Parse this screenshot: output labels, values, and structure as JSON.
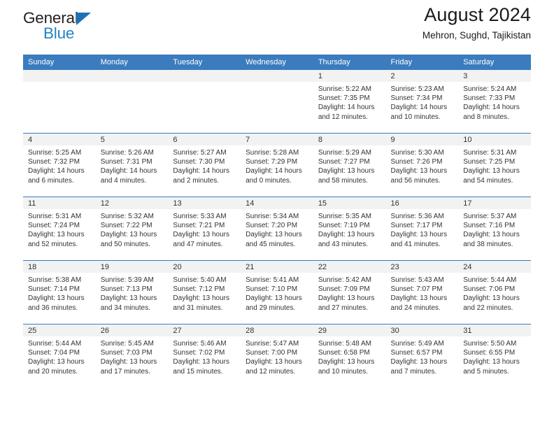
{
  "brand": {
    "name_top": "General",
    "name_bottom": "Blue",
    "accent_color": "#2483c5",
    "triangle_color": "#1b72b8"
  },
  "header": {
    "title": "August 2024",
    "subtitle": "Mehron, Sughd, Tajikistan"
  },
  "theme": {
    "header_row_bg": "#3a7cbe",
    "daynum_band_bg": "#f2f2f2",
    "grid_line": "#3a7cbe",
    "text": "#333333"
  },
  "calendar": {
    "weekday_headers": [
      "Sunday",
      "Monday",
      "Tuesday",
      "Wednesday",
      "Thursday",
      "Friday",
      "Saturday"
    ],
    "weeks": [
      [
        {
          "day": "",
          "lines": []
        },
        {
          "day": "",
          "lines": []
        },
        {
          "day": "",
          "lines": []
        },
        {
          "day": "",
          "lines": []
        },
        {
          "day": "1",
          "lines": [
            "Sunrise: 5:22 AM",
            "Sunset: 7:35 PM",
            "Daylight: 14 hours",
            "and 12 minutes."
          ]
        },
        {
          "day": "2",
          "lines": [
            "Sunrise: 5:23 AM",
            "Sunset: 7:34 PM",
            "Daylight: 14 hours",
            "and 10 minutes."
          ]
        },
        {
          "day": "3",
          "lines": [
            "Sunrise: 5:24 AM",
            "Sunset: 7:33 PM",
            "Daylight: 14 hours",
            "and 8 minutes."
          ]
        }
      ],
      [
        {
          "day": "4",
          "lines": [
            "Sunrise: 5:25 AM",
            "Sunset: 7:32 PM",
            "Daylight: 14 hours",
            "and 6 minutes."
          ]
        },
        {
          "day": "5",
          "lines": [
            "Sunrise: 5:26 AM",
            "Sunset: 7:31 PM",
            "Daylight: 14 hours",
            "and 4 minutes."
          ]
        },
        {
          "day": "6",
          "lines": [
            "Sunrise: 5:27 AM",
            "Sunset: 7:30 PM",
            "Daylight: 14 hours",
            "and 2 minutes."
          ]
        },
        {
          "day": "7",
          "lines": [
            "Sunrise: 5:28 AM",
            "Sunset: 7:29 PM",
            "Daylight: 14 hours",
            "and 0 minutes."
          ]
        },
        {
          "day": "8",
          "lines": [
            "Sunrise: 5:29 AM",
            "Sunset: 7:27 PM",
            "Daylight: 13 hours",
            "and 58 minutes."
          ]
        },
        {
          "day": "9",
          "lines": [
            "Sunrise: 5:30 AM",
            "Sunset: 7:26 PM",
            "Daylight: 13 hours",
            "and 56 minutes."
          ]
        },
        {
          "day": "10",
          "lines": [
            "Sunrise: 5:31 AM",
            "Sunset: 7:25 PM",
            "Daylight: 13 hours",
            "and 54 minutes."
          ]
        }
      ],
      [
        {
          "day": "11",
          "lines": [
            "Sunrise: 5:31 AM",
            "Sunset: 7:24 PM",
            "Daylight: 13 hours",
            "and 52 minutes."
          ]
        },
        {
          "day": "12",
          "lines": [
            "Sunrise: 5:32 AM",
            "Sunset: 7:22 PM",
            "Daylight: 13 hours",
            "and 50 minutes."
          ]
        },
        {
          "day": "13",
          "lines": [
            "Sunrise: 5:33 AM",
            "Sunset: 7:21 PM",
            "Daylight: 13 hours",
            "and 47 minutes."
          ]
        },
        {
          "day": "14",
          "lines": [
            "Sunrise: 5:34 AM",
            "Sunset: 7:20 PM",
            "Daylight: 13 hours",
            "and 45 minutes."
          ]
        },
        {
          "day": "15",
          "lines": [
            "Sunrise: 5:35 AM",
            "Sunset: 7:19 PM",
            "Daylight: 13 hours",
            "and 43 minutes."
          ]
        },
        {
          "day": "16",
          "lines": [
            "Sunrise: 5:36 AM",
            "Sunset: 7:17 PM",
            "Daylight: 13 hours",
            "and 41 minutes."
          ]
        },
        {
          "day": "17",
          "lines": [
            "Sunrise: 5:37 AM",
            "Sunset: 7:16 PM",
            "Daylight: 13 hours",
            "and 38 minutes."
          ]
        }
      ],
      [
        {
          "day": "18",
          "lines": [
            "Sunrise: 5:38 AM",
            "Sunset: 7:14 PM",
            "Daylight: 13 hours",
            "and 36 minutes."
          ]
        },
        {
          "day": "19",
          "lines": [
            "Sunrise: 5:39 AM",
            "Sunset: 7:13 PM",
            "Daylight: 13 hours",
            "and 34 minutes."
          ]
        },
        {
          "day": "20",
          "lines": [
            "Sunrise: 5:40 AM",
            "Sunset: 7:12 PM",
            "Daylight: 13 hours",
            "and 31 minutes."
          ]
        },
        {
          "day": "21",
          "lines": [
            "Sunrise: 5:41 AM",
            "Sunset: 7:10 PM",
            "Daylight: 13 hours",
            "and 29 minutes."
          ]
        },
        {
          "day": "22",
          "lines": [
            "Sunrise: 5:42 AM",
            "Sunset: 7:09 PM",
            "Daylight: 13 hours",
            "and 27 minutes."
          ]
        },
        {
          "day": "23",
          "lines": [
            "Sunrise: 5:43 AM",
            "Sunset: 7:07 PM",
            "Daylight: 13 hours",
            "and 24 minutes."
          ]
        },
        {
          "day": "24",
          "lines": [
            "Sunrise: 5:44 AM",
            "Sunset: 7:06 PM",
            "Daylight: 13 hours",
            "and 22 minutes."
          ]
        }
      ],
      [
        {
          "day": "25",
          "lines": [
            "Sunrise: 5:44 AM",
            "Sunset: 7:04 PM",
            "Daylight: 13 hours",
            "and 20 minutes."
          ]
        },
        {
          "day": "26",
          "lines": [
            "Sunrise: 5:45 AM",
            "Sunset: 7:03 PM",
            "Daylight: 13 hours",
            "and 17 minutes."
          ]
        },
        {
          "day": "27",
          "lines": [
            "Sunrise: 5:46 AM",
            "Sunset: 7:02 PM",
            "Daylight: 13 hours",
            "and 15 minutes."
          ]
        },
        {
          "day": "28",
          "lines": [
            "Sunrise: 5:47 AM",
            "Sunset: 7:00 PM",
            "Daylight: 13 hours",
            "and 12 minutes."
          ]
        },
        {
          "day": "29",
          "lines": [
            "Sunrise: 5:48 AM",
            "Sunset: 6:58 PM",
            "Daylight: 13 hours",
            "and 10 minutes."
          ]
        },
        {
          "day": "30",
          "lines": [
            "Sunrise: 5:49 AM",
            "Sunset: 6:57 PM",
            "Daylight: 13 hours",
            "and 7 minutes."
          ]
        },
        {
          "day": "31",
          "lines": [
            "Sunrise: 5:50 AM",
            "Sunset: 6:55 PM",
            "Daylight: 13 hours",
            "and 5 minutes."
          ]
        }
      ]
    ]
  }
}
